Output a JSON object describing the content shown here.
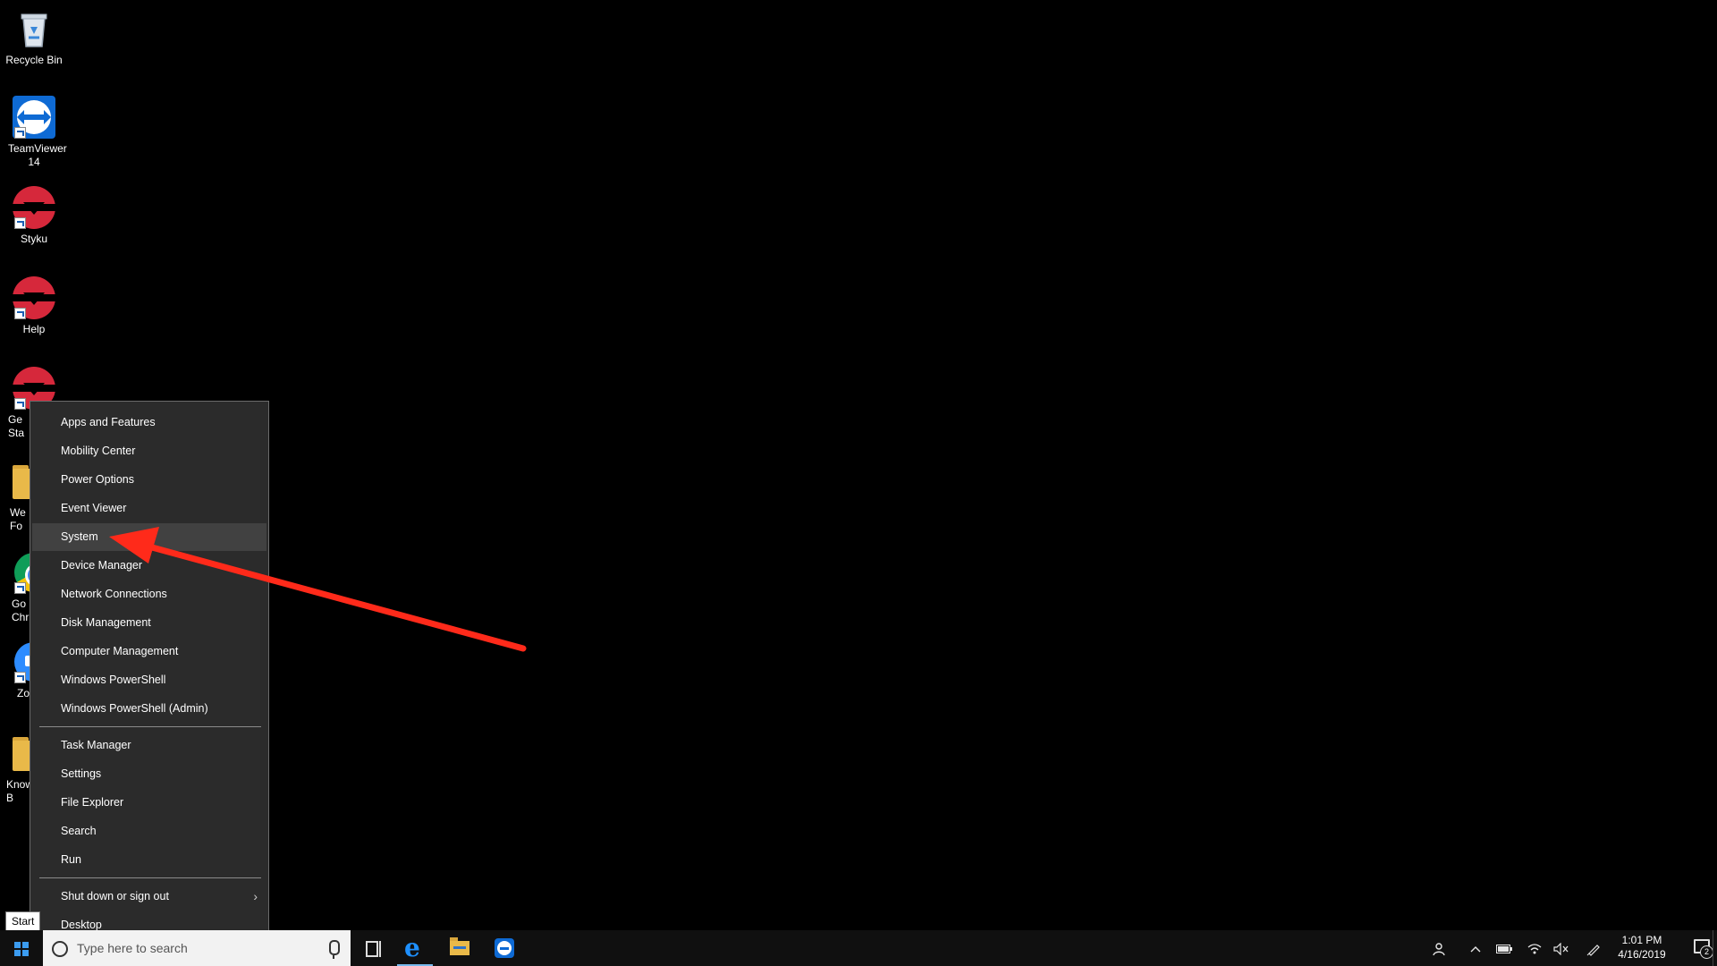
{
  "desktop": {
    "icons": [
      {
        "label": "Recycle Bin"
      },
      {
        "label": "TeamViewer 14"
      },
      {
        "label": "Styku"
      },
      {
        "label": "Help"
      },
      {
        "label": "Ge Sta"
      },
      {
        "label": "We Fo"
      },
      {
        "label": "Go Chr"
      },
      {
        "label": "Zo"
      },
      {
        "label": "Know B"
      }
    ]
  },
  "context_menu": {
    "group1": [
      "Apps and Features",
      "Mobility Center",
      "Power Options",
      "Event Viewer",
      "System",
      "Device Manager",
      "Network Connections",
      "Disk Management",
      "Computer Management",
      "Windows PowerShell",
      "Windows PowerShell (Admin)"
    ],
    "group2": [
      "Task Manager",
      "Settings",
      "File Explorer",
      "Search",
      "Run"
    ],
    "group3": [
      "Shut down or sign out",
      "Desktop"
    ],
    "highlighted": "System"
  },
  "annotation": {
    "color": "#ff2a1a"
  },
  "tooltip": {
    "text": "Start"
  },
  "taskbar": {
    "search_placeholder": "Type here to search",
    "clock_time": "1:01 PM",
    "clock_date": "4/16/2019",
    "notification_count": "2",
    "accent": "#3b9cf0"
  }
}
